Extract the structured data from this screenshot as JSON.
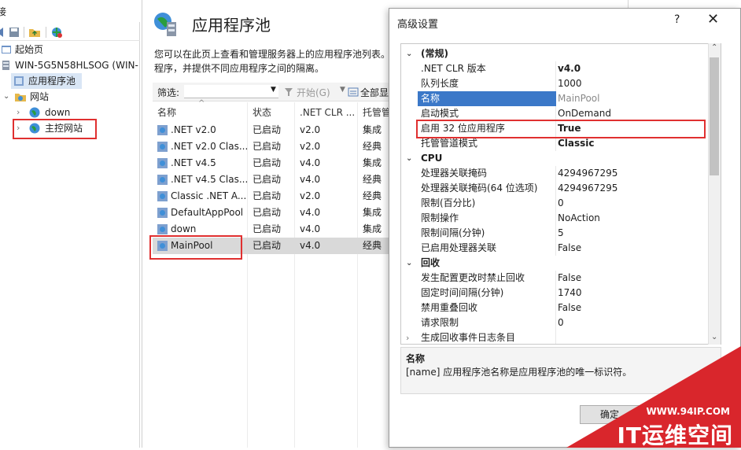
{
  "left": {
    "header_title": "接",
    "tree": [
      {
        "label": "起始页"
      },
      {
        "label": "WIN-5G5N58HLSOG (WIN-",
        "suffix": ""
      },
      {
        "label": "应用程序池"
      },
      {
        "label": "网站"
      },
      {
        "label": "down"
      },
      {
        "label": "主控网站"
      }
    ]
  },
  "middle": {
    "title": "应用程序池",
    "description": "您可以在此页上查看和管理服务器上的应用程序池列表。程序，并提供不同应用程序之间的隔离。",
    "filter_label": "筛选:",
    "start_label": "开始(G)",
    "show_all_label": "全部显",
    "columns": [
      "名称",
      "状态",
      ".NET CLR ...",
      "托管管"
    ],
    "pools": [
      {
        "name": ".NET v2.0",
        "status": "已启动",
        "clr": "v2.0",
        "mode": "集成"
      },
      {
        "name": ".NET v2.0 Clas...",
        "status": "已启动",
        "clr": "v2.0",
        "mode": "经典"
      },
      {
        "name": ".NET v4.5",
        "status": "已启动",
        "clr": "v4.0",
        "mode": "集成"
      },
      {
        "name": ".NET v4.5 Clas...",
        "status": "已启动",
        "clr": "v4.0",
        "mode": "经典"
      },
      {
        "name": "Classic .NET A...",
        "status": "已启动",
        "clr": "v2.0",
        "mode": "经典"
      },
      {
        "name": "DefaultAppPool",
        "status": "已启动",
        "clr": "v4.0",
        "mode": "集成"
      },
      {
        "name": "down",
        "status": "已启动",
        "clr": "v4.0",
        "mode": "集成"
      },
      {
        "name": "MainPool",
        "status": "已启动",
        "clr": "v4.0",
        "mode": "经典"
      }
    ]
  },
  "dialog": {
    "title": "高级设置",
    "help": "?",
    "close": "✕",
    "categories": [
      {
        "name": "(常规)",
        "props": [
          {
            "name": ".NET CLR 版本",
            "value": "v4.0"
          },
          {
            "name": "队列长度",
            "value": "1000"
          },
          {
            "name": "名称",
            "value": "MainPool"
          },
          {
            "name": "启动模式",
            "value": "OnDemand"
          },
          {
            "name": "启用 32 位应用程序",
            "value": "True"
          },
          {
            "name": "托管管道模式",
            "value": "Classic"
          }
        ]
      },
      {
        "name": "CPU",
        "props": [
          {
            "name": "处理器关联掩码",
            "value": "4294967295"
          },
          {
            "name": "处理器关联掩码(64 位选项)",
            "value": "4294967295"
          },
          {
            "name": "限制(百分比)",
            "value": "0"
          },
          {
            "name": "限制操作",
            "value": "NoAction"
          },
          {
            "name": "限制间隔(分钟)",
            "value": "5"
          },
          {
            "name": "已启用处理器关联",
            "value": "False"
          }
        ]
      },
      {
        "name": "回收",
        "props": [
          {
            "name": "发生配置更改时禁止回收",
            "value": "False"
          },
          {
            "name": "固定时间间隔(分钟)",
            "value": "1740"
          },
          {
            "name": "禁用重叠回收",
            "value": "False"
          },
          {
            "name": "请求限制",
            "value": "0"
          },
          {
            "name": "生成回收事件日志条目",
            "value": ""
          }
        ]
      }
    ],
    "desc_title": "名称",
    "desc_text": "[name] 应用程序池名称是应用程序池的唯一标识符。",
    "ok_label": "确定"
  },
  "watermark": {
    "url": "WWW.94IP.COM",
    "brand": "IT运维空间"
  },
  "colors": {
    "highlight_red": "#e03030",
    "selection_blue": "#3b78c8",
    "watermark_red": "#d9262c"
  }
}
